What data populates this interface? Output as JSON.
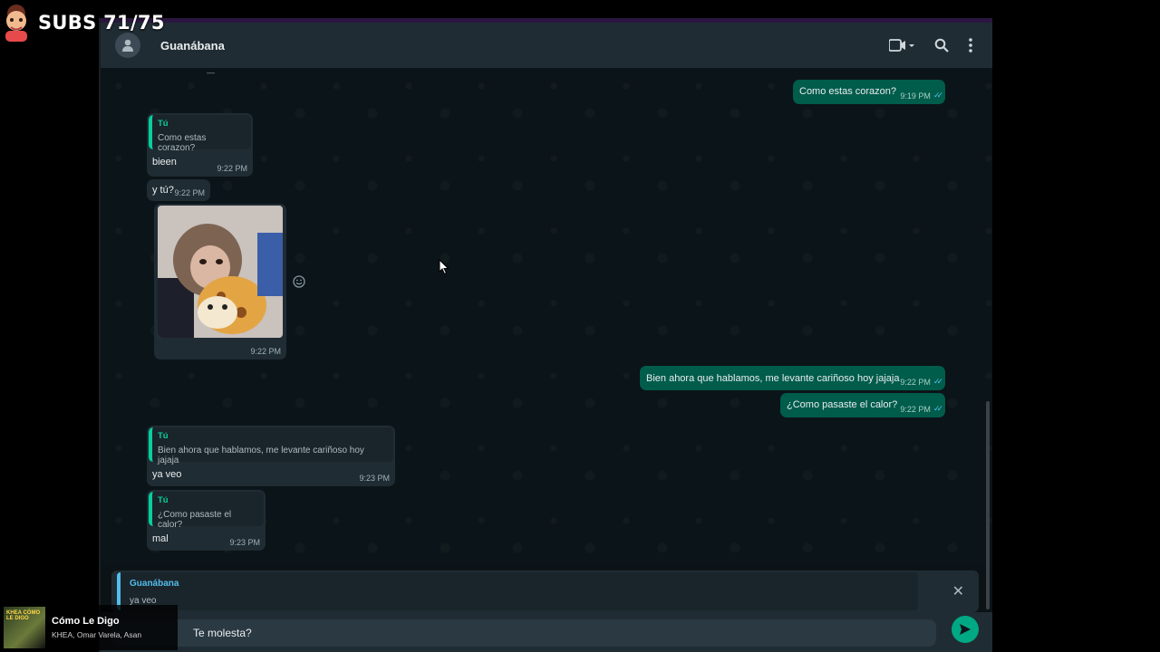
{
  "overlay": {
    "subs_text": "SUBS 71/75"
  },
  "header": {
    "contact_name": "Guanábana"
  },
  "messages": [
    {
      "id": "m1",
      "text": "Como estas corazon?",
      "time": "9:19 PM"
    },
    {
      "id": "m2",
      "quote_name": "Tú",
      "quote_text": "Como estas corazon?",
      "text": "bieen",
      "time": "9:22 PM"
    },
    {
      "id": "m3",
      "text": "y tú?",
      "time": "9:22 PM"
    },
    {
      "id": "m4",
      "time": "9:22 PM"
    },
    {
      "id": "m5",
      "text": "Bien ahora que hablamos, me levante cariñoso hoy jajaja",
      "time": "9:22 PM"
    },
    {
      "id": "m6",
      "text": "¿Como pasaste el calor?",
      "time": "9:22 PM"
    },
    {
      "id": "m7",
      "quote_name": "Tú",
      "quote_text": "Bien ahora que hablamos, me levante cariñoso hoy jajaja",
      "text": "ya veo",
      "time": "9:23 PM"
    },
    {
      "id": "m8",
      "quote_name": "Tú",
      "quote_text": "¿Como pasaste el calor?",
      "text": "mal",
      "time": "9:23 PM"
    }
  ],
  "reply": {
    "name": "Guanábana",
    "text": "ya veo"
  },
  "compose": {
    "value": "Te molesta?"
  },
  "now_playing": {
    "title": "Cómo Le Digo",
    "artist": "KHEA, Omar Varela, Asan",
    "album_text": "KHEA CÓMO LE DIGO"
  },
  "colors": {
    "incoming": "#202c33",
    "outgoing": "#005c4b",
    "accent": "#06cf9c",
    "send": "#00a884"
  }
}
